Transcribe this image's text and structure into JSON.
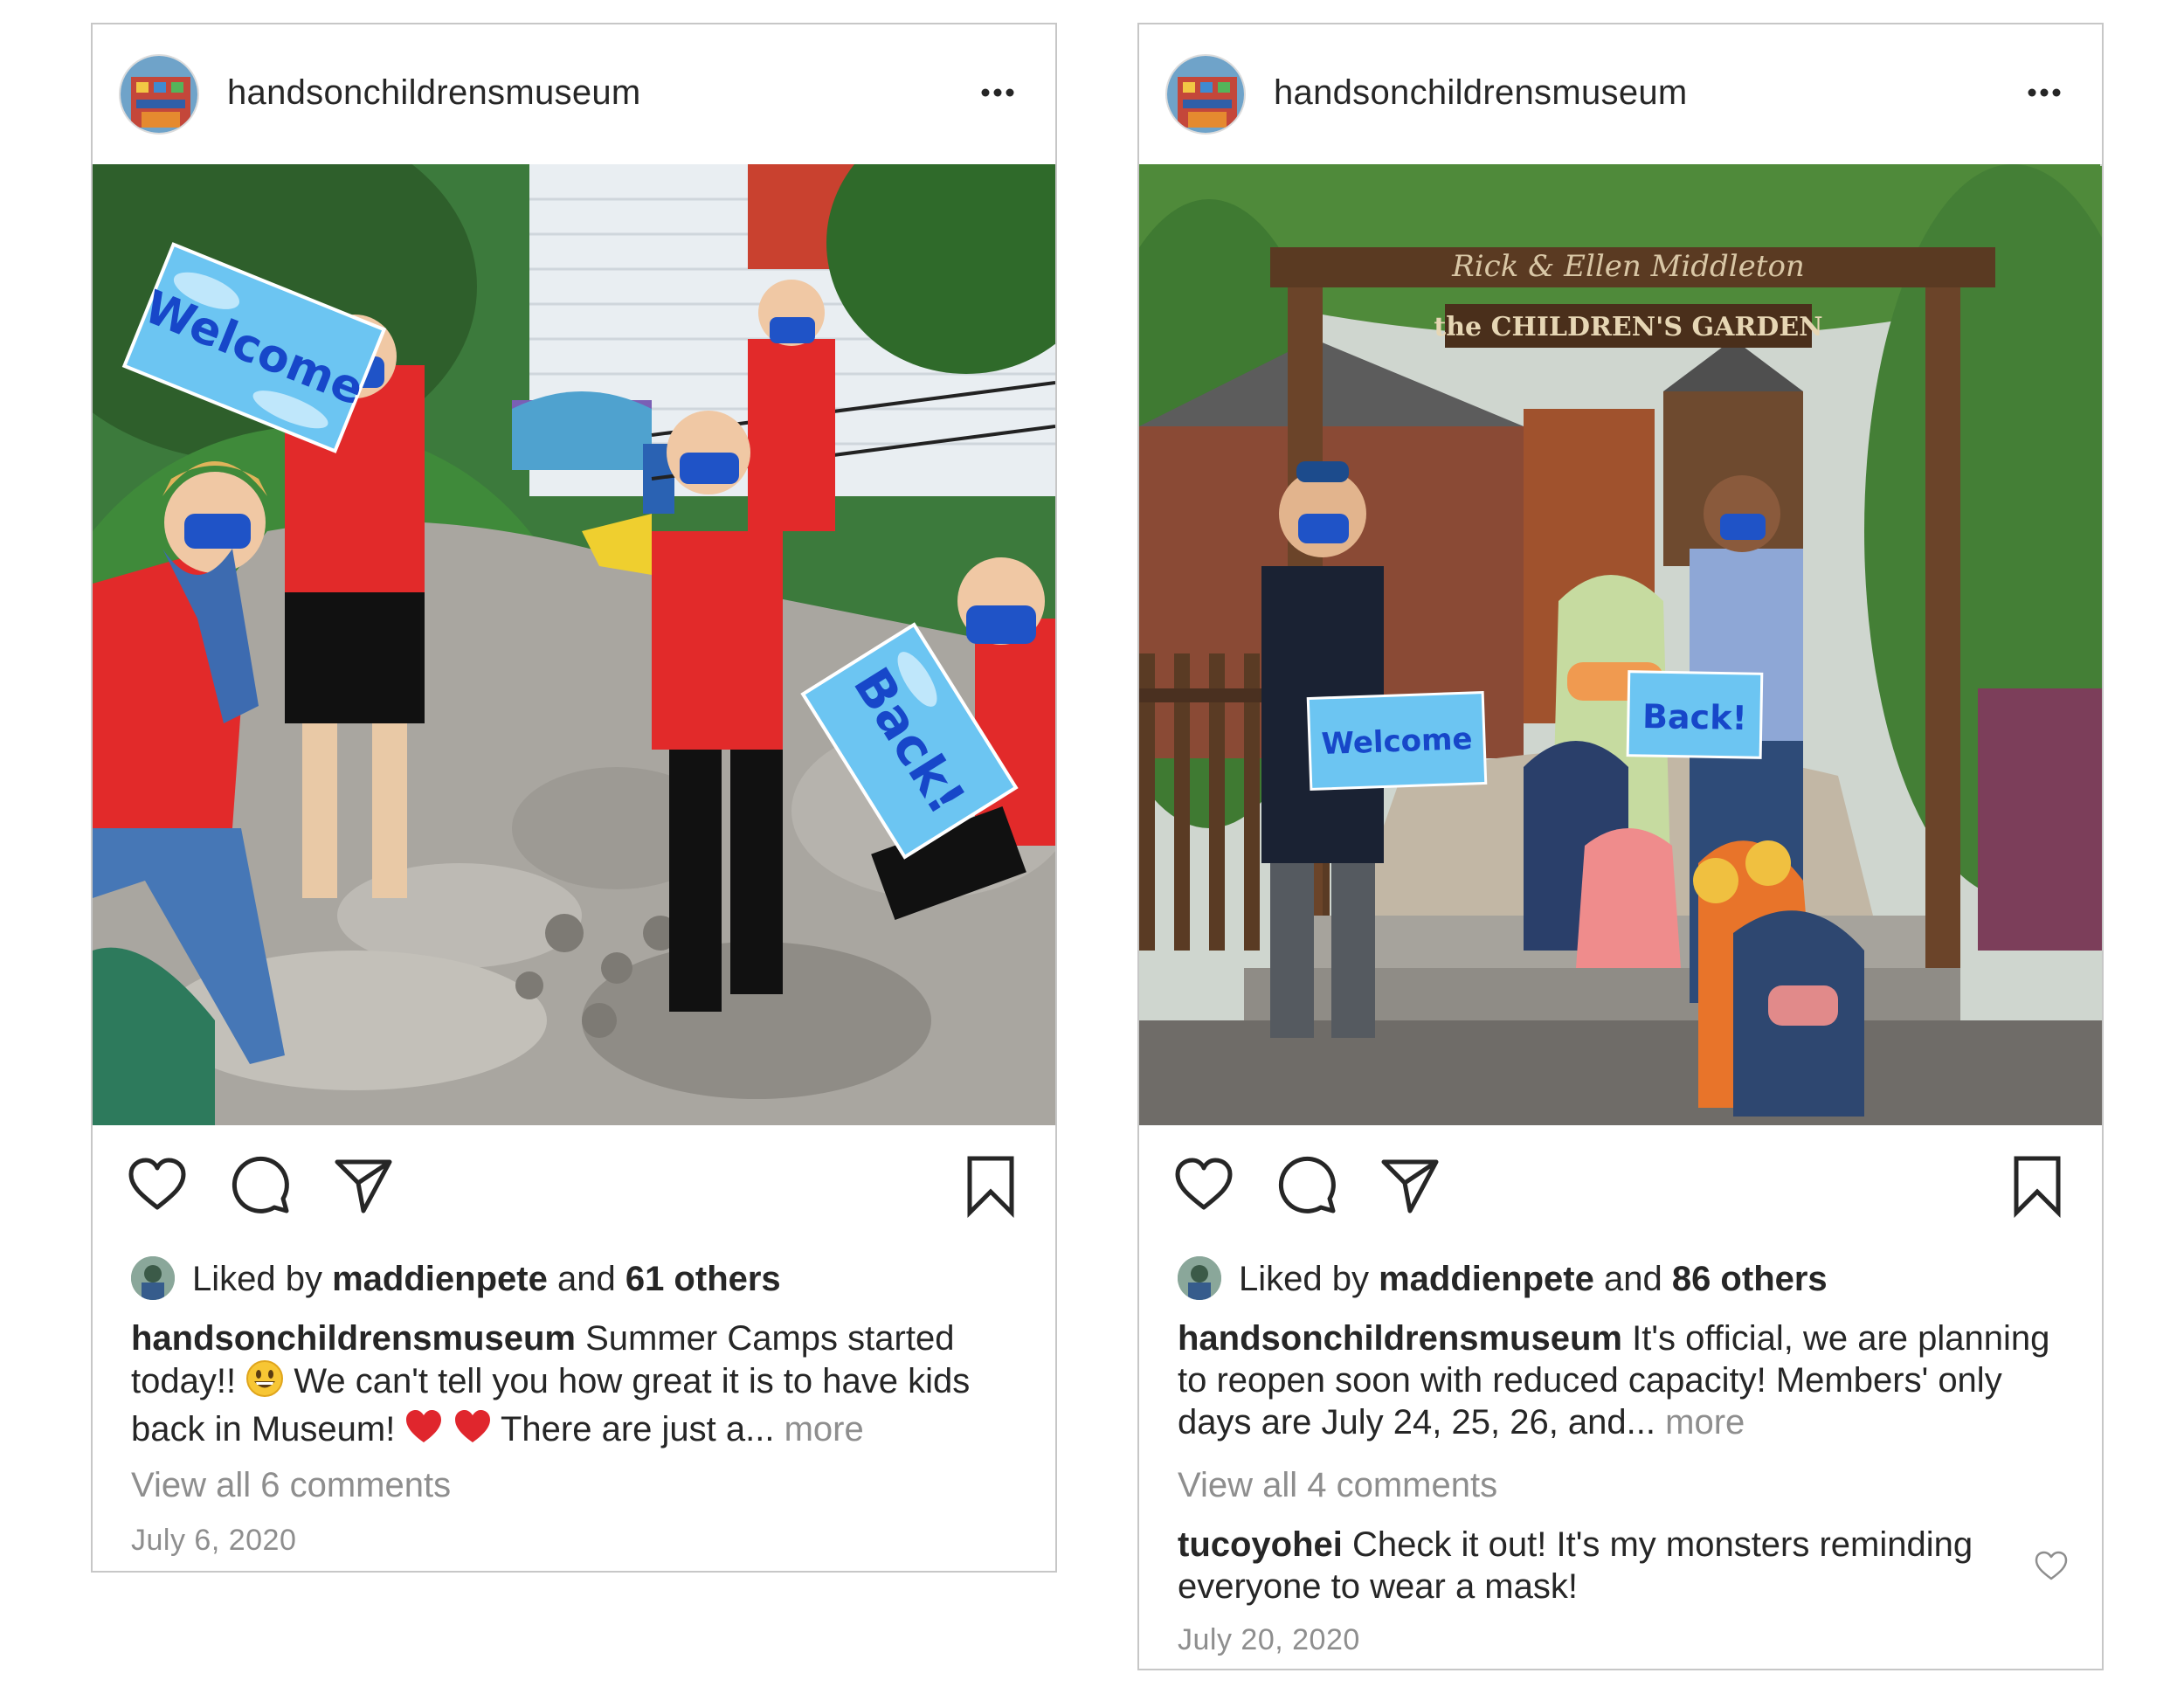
{
  "posts": [
    {
      "username": "handsonchildrensmuseum",
      "photo": {
        "sign_welcome": "Welcome",
        "sign_back": "Back!"
      },
      "likes": {
        "prefix": "Liked by",
        "liker": "maddienpete",
        "joiner": "and",
        "others": "61 others"
      },
      "caption": {
        "username": "handsonchildrensmuseum",
        "text_1": "Summer Camps started today!!",
        "text_2": "We can't tell you how great it is to have kids back in Museum!",
        "text_3": "There are just a...",
        "more": "more"
      },
      "view_comments": "View all 6 comments",
      "date": "July 6, 2020"
    },
    {
      "username": "handsonchildrensmuseum",
      "photo": {
        "arch_top": "Rick & Ellen Middleton",
        "arch_bottom": "the CHILDREN'S GARDEN",
        "sign_welcome": "Welcome",
        "sign_back": "Back!"
      },
      "likes": {
        "prefix": "Liked by",
        "liker": "maddienpete",
        "joiner": "and",
        "others": "86 others"
      },
      "caption": {
        "username": "handsonchildrensmuseum",
        "text_1": "It's official, we are planning to reopen soon with reduced capacity! Members' only days are July 24, 25, 26, and...",
        "more": "more"
      },
      "view_comments": "View all 4 comments",
      "comment": {
        "username": "tucoyohei",
        "text": "Check it out! It's my monsters reminding everyone to wear a mask!"
      },
      "date": "July 20, 2020"
    }
  ]
}
